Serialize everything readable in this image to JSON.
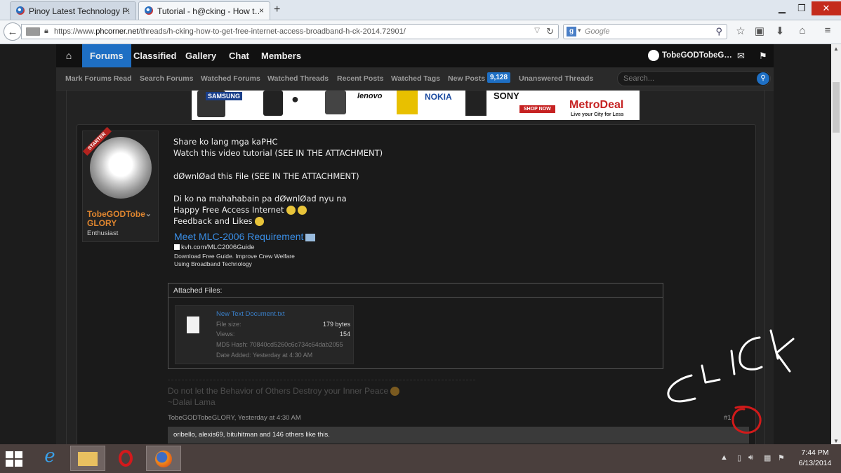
{
  "browser": {
    "tabs": [
      {
        "label": "Pinoy Latest Technology F…",
        "close": "×"
      },
      {
        "label": "Tutorial - h@cking - How t…",
        "close": "×"
      }
    ],
    "new_tab": "+",
    "url_prefix": "https://www.",
    "url_domain": "phcorner.net",
    "url_path": "/threads/h-cking-how-to-get-free-internet-access-broadband-h-ck-2014.72901/",
    "search_engine": "Google",
    "search_placeholder": "Google"
  },
  "site": {
    "nav": [
      "Forums",
      "Classified",
      "Gallery",
      "Chat",
      "Members"
    ],
    "active_nav": "Forums",
    "username_short": "TobeGODTobeG…",
    "subnav": [
      "Mark Forums Read",
      "Search Forums",
      "Watched Forums",
      "Watched Threads",
      "Recent Posts",
      "Watched Tags",
      "New Posts",
      "Unanswered Threads"
    ],
    "new_posts_count": "9,128",
    "search_placeholder": "Search..."
  },
  "banner": {
    "brands": [
      "SAMSUNG",
      "lenovo",
      "NOKIA",
      "SONY",
      "SHOP NOW",
      "MetroDeal",
      "Live your City for Less"
    ]
  },
  "post": {
    "ribbon": "STARTER",
    "author": "TobeGODTobe GLORY",
    "author_title": "Enthusiast",
    "lines": [
      "Share ko lang mga kaPHC",
      "Watch this video tutorial (SEE IN THE ATTACHMENT)",
      "dØwnlØad this File (SEE IN THE ATTACHMENT)",
      "Di ko na mahahabain pa dØwnlØad nyu na",
      "Happy Free Access Internet",
      "Feedback and Likes"
    ],
    "ad_title": "Meet MLC-2006 Requirement",
    "ad_url": "kvh.com/MLC2006Guide",
    "ad_desc1": "Download Free Guide. Improve Crew Welfare",
    "ad_desc2": "Using Broadband Technology",
    "attached_label": "Attached Files:",
    "file": {
      "name": "New Text Document.txt",
      "size_label": "File size:",
      "size": "179 bytes",
      "views_label": "Views:",
      "views": "154",
      "md5_label": "MD5 Hash:",
      "md5": "70840cd5260c6c734c64dab2055",
      "date_label": "Date Added:",
      "date": "Yesterday at 4:30 AM"
    },
    "signature1": "Do not let the Behavior of Others Destroy your Inner Peace",
    "signature2": "~Dalai Lama",
    "meta": "TobeGODTobeGLORY, Yesterday at 4:30 AM",
    "post_number": "#1",
    "likes": "oribello, alexis69, bituhitman and 146 others like this."
  },
  "annotation": {
    "text": "CLICK",
    "color": "#d11a1a"
  },
  "taskbar": {
    "time": "7:44 PM",
    "date": "6/13/2014"
  }
}
